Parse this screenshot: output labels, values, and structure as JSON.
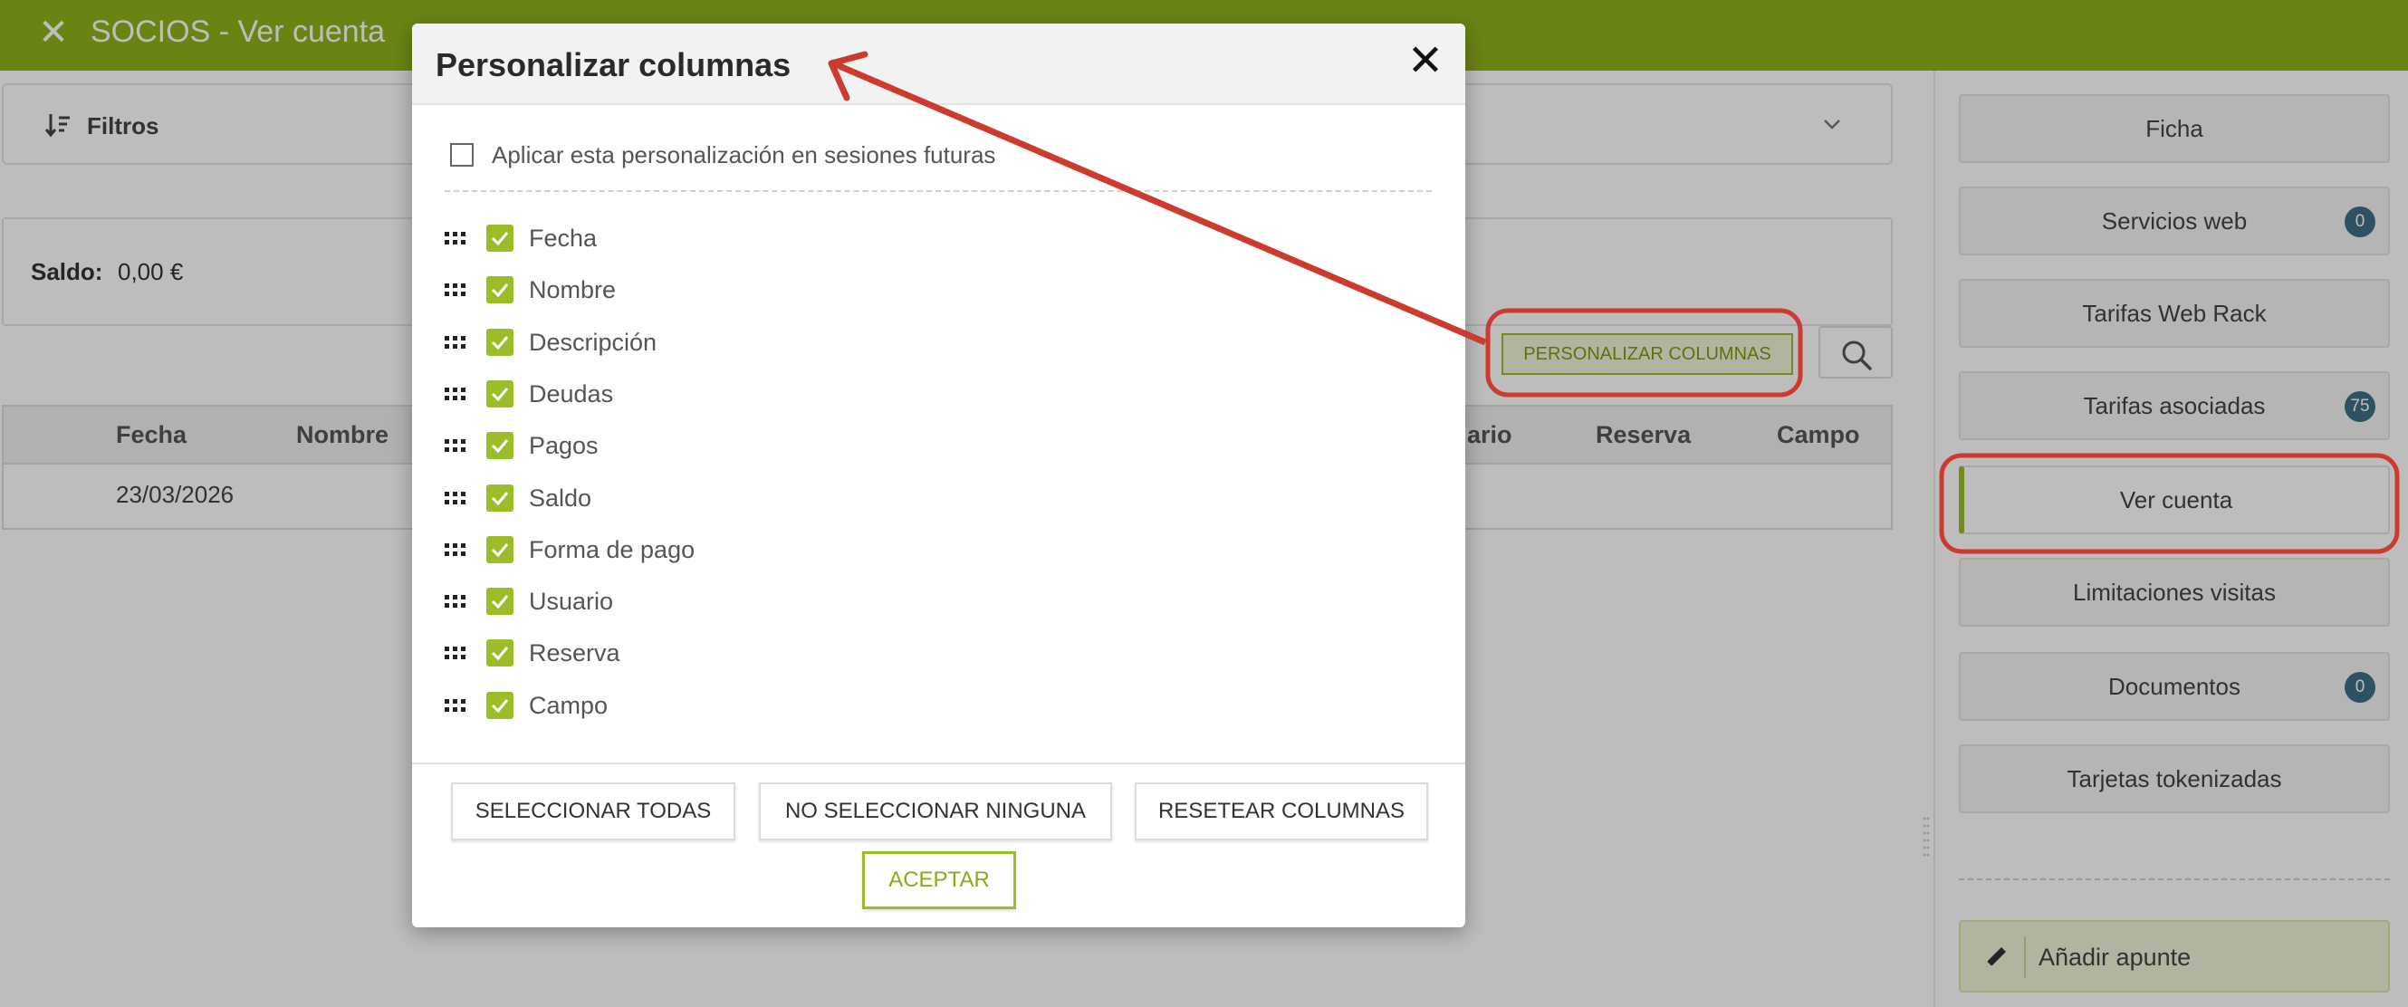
{
  "header": {
    "title": "SOCIOS - Ver cuenta"
  },
  "filters": {
    "label": "Filtros"
  },
  "saldo": {
    "label": "Saldo:",
    "value": "0,00 €"
  },
  "toolbar": {
    "personalizar_label": "PERSONALIZAR COLUMNAS"
  },
  "table": {
    "headers": {
      "fecha": "Fecha",
      "nombre": "Nombre",
      "usuario_partial": "ario",
      "reserva": "Reserva",
      "campo": "Campo"
    },
    "rows": [
      {
        "fecha": "23/03/2026"
      }
    ]
  },
  "sidebar": {
    "items": [
      {
        "label": "Ficha"
      },
      {
        "label": "Servicios web",
        "badge": "0"
      },
      {
        "label": "Tarifas Web Rack"
      },
      {
        "label": "Tarifas asociadas",
        "badge": "75"
      },
      {
        "label": "Ver cuenta"
      },
      {
        "label": "Limitaciones visitas"
      },
      {
        "label": "Documentos",
        "badge": "0"
      },
      {
        "label": "Tarjetas tokenizadas"
      }
    ],
    "add_apunte": "Añadir apunte"
  },
  "modal": {
    "title": "Personalizar columnas",
    "future_label": "Aplicar esta personalización en sesiones futuras",
    "columns": [
      {
        "label": "Fecha",
        "checked": true
      },
      {
        "label": "Nombre",
        "checked": true
      },
      {
        "label": "Descripción",
        "checked": true
      },
      {
        "label": "Deudas",
        "checked": true
      },
      {
        "label": "Pagos",
        "checked": true
      },
      {
        "label": "Saldo",
        "checked": true
      },
      {
        "label": "Forma de pago",
        "checked": true
      },
      {
        "label": "Usuario",
        "checked": true
      },
      {
        "label": "Reserva",
        "checked": true
      },
      {
        "label": "Campo",
        "checked": true
      }
    ],
    "buttons": {
      "select_all": "SELECCIONAR TODAS",
      "select_none": "NO SELECCIONAR NINGUNA",
      "reset": "RESETEAR COLUMNAS",
      "accept": "ACEPTAR"
    }
  },
  "colors": {
    "brand": "#8fb21b",
    "accent": "#9bbd2a",
    "badge": "#3d6f86",
    "annotation": "#cc3b2e"
  }
}
